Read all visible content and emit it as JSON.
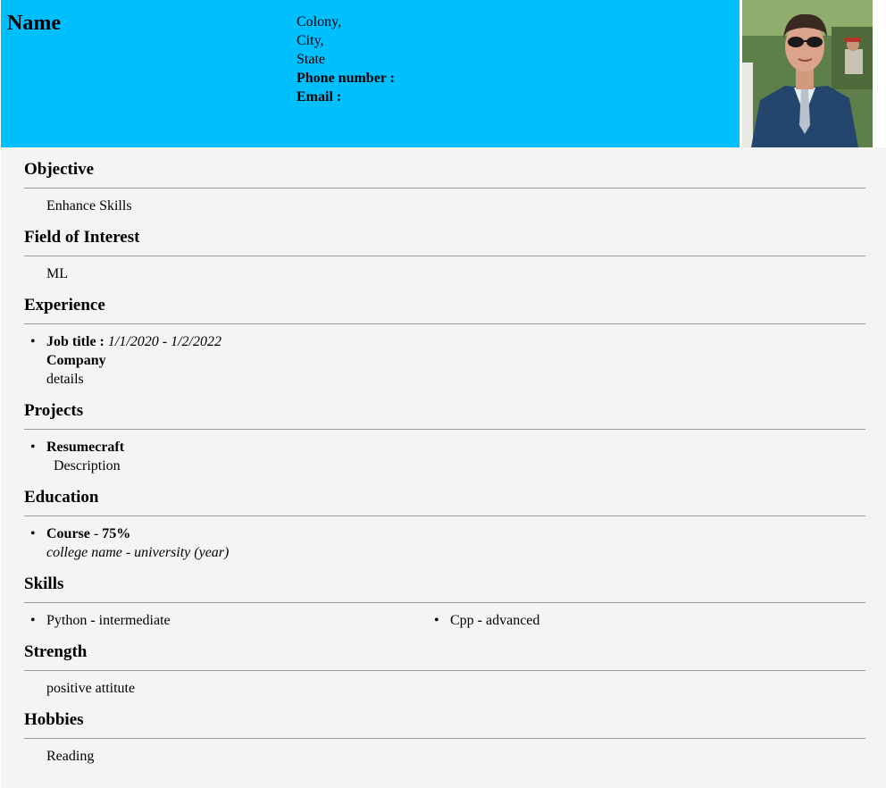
{
  "header": {
    "name": "Name",
    "address_line1": "Colony,",
    "address_line2": "City,",
    "address_line3": "State",
    "phone_label": "Phone number :",
    "email_label": "Email :"
  },
  "sections": {
    "objective": {
      "title": "Objective",
      "text": "Enhance Skills"
    },
    "interest": {
      "title": "Field of Interest",
      "text": "ML"
    },
    "experience": {
      "title": "Experience",
      "job_title": "Job title :",
      "dates": "1/1/2020 - 1/2/2022",
      "company": "Company",
      "details": "details"
    },
    "projects": {
      "title": "Projects",
      "project_name": "Resumecraft",
      "project_desc": "Description"
    },
    "education": {
      "title": "Education",
      "course": "Course",
      "sep": " - ",
      "score": "75%",
      "college": "college name - university (year)"
    },
    "skills": {
      "title": "Skills",
      "items": [
        {
          "name": "Python",
          "sep": " - ",
          "level": "intermediate"
        },
        {
          "name": "Cpp",
          "sep": " - ",
          "level": "advanced"
        }
      ]
    },
    "strength": {
      "title": "Strength",
      "text": "positive attitute"
    },
    "hobbies": {
      "title": "Hobbies",
      "text": "Reading"
    }
  },
  "colors": {
    "header_bg": "#00bfff",
    "body_bg": "#f4f4f4",
    "rule": "#999999"
  }
}
